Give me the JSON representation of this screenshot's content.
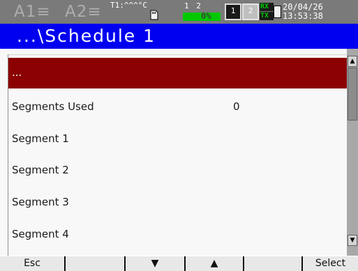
{
  "status_bar": {
    "alarm_1": "A1≡",
    "alarm_2": "A2≡",
    "temperature": "T1:^^^°C",
    "sd_card_icon": "sd-card-icon",
    "channel_numbers": "1 2",
    "memory_used": "0%",
    "memory_bar_fill": 0,
    "channel_1_label": "1",
    "channel_2_label": "2",
    "rx_label": "RX",
    "tx_label": "TX",
    "date": "20/04/26",
    "time": "13:53:38"
  },
  "title_bar": {
    "title": "...\\Schedule 1"
  },
  "list": {
    "rows": [
      {
        "label": "...",
        "value": "",
        "selected": true
      },
      {
        "label": "Segments Used",
        "value": "0",
        "selected": false
      },
      {
        "label": "Segment 1",
        "value": "",
        "selected": false
      },
      {
        "label": "Segment 2",
        "value": "",
        "selected": false
      },
      {
        "label": "Segment 3",
        "value": "",
        "selected": false
      },
      {
        "label": "Segment 4",
        "value": "",
        "selected": false
      }
    ]
  },
  "scrollbar": {
    "up_icon": "arrow-up-icon",
    "down_icon": "arrow-down-icon",
    "up_glyph": "▲",
    "down_glyph": "▼"
  },
  "softkeys": {
    "esc": "Esc",
    "key_2": "",
    "down": "▼",
    "up": "▲",
    "key_5": "",
    "select": "Select"
  },
  "colors": {
    "status_bar_bg": "#7a7a7a",
    "title_bar_bg": "#0000f0",
    "selected_row_bg": "#8b0000",
    "memory_bar": "#00c800",
    "softkey_bg": "#e8e8e8"
  }
}
